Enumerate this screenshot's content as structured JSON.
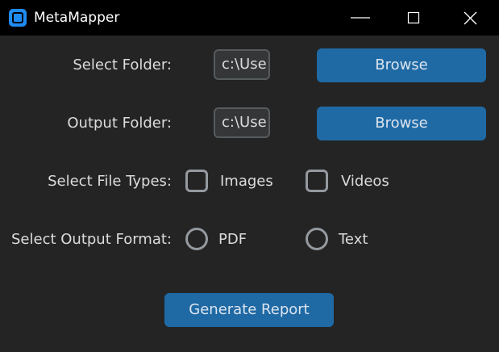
{
  "window": {
    "title": "MetaMapper",
    "app_icon": "app-logo-icon",
    "controls": {
      "minimize_icon": "minimize-icon",
      "maximize_icon": "maximize-icon",
      "close_icon": "close-icon"
    }
  },
  "form": {
    "select_folder": {
      "label": "Select Folder:",
      "value": "c:\\Use",
      "button_label": "Browse"
    },
    "output_folder": {
      "label": "Output Folder:",
      "value": "c:\\Use",
      "button_label": "Browse"
    },
    "file_types": {
      "label": "Select File Types:",
      "options": [
        {
          "label": "Images",
          "checked": false
        },
        {
          "label": "Videos",
          "checked": false
        }
      ]
    },
    "output_format": {
      "label": "Select Output Format:",
      "options": [
        {
          "label": "PDF",
          "selected": false
        },
        {
          "label": "Text",
          "selected": false
        }
      ]
    },
    "generate_button": "Generate Report"
  },
  "colors": {
    "titlebar_bg": "#000000",
    "window_bg": "#242424",
    "accent": "#1f6aa5",
    "entry_bg": "#343638",
    "entry_border": "#565b5e",
    "control_border": "#949a9f",
    "text": "#dcdcdc"
  }
}
